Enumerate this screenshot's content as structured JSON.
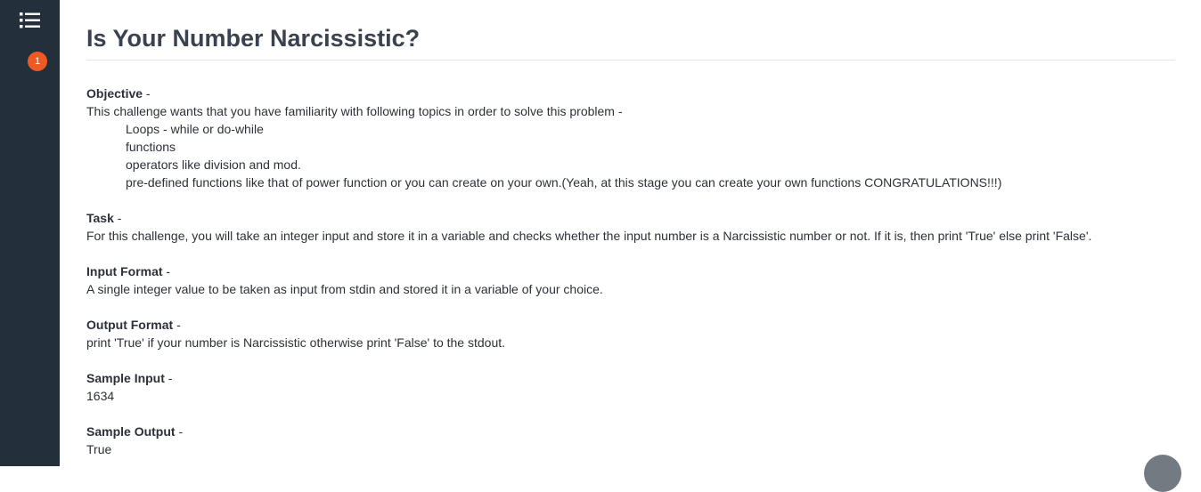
{
  "notification_count": "1",
  "title": "Is Your Number Narcissistic?",
  "objective": {
    "heading": "Objective",
    "intro": "This challenge wants that you have familiarity with following topics in order to solve this problem -",
    "items": [
      "Loops - while or do-while",
      "functions",
      "operators like division and mod.",
      "pre-defined functions like that of power function or you can create on your own.(Yeah, at this stage you can create your own functions CONGRATULATIONS!!!)"
    ]
  },
  "task": {
    "heading": "Task",
    "text": "For this challenge, you will take an integer input and store it in a variable and checks whether the input number is a Narcissistic number or not. If it is, then print 'True' else print 'False'."
  },
  "input_format": {
    "heading": "Input Format",
    "text": "A single integer value to be taken as input from stdin and stored it in a variable of your choice."
  },
  "output_format": {
    "heading": "Output Format",
    "text": "print 'True' if your number is Narcissistic otherwise print 'False' to the stdout."
  },
  "sample_input": {
    "heading": "Sample Input",
    "text": "1634"
  },
  "sample_output": {
    "heading": "Sample Output",
    "text": "True"
  }
}
